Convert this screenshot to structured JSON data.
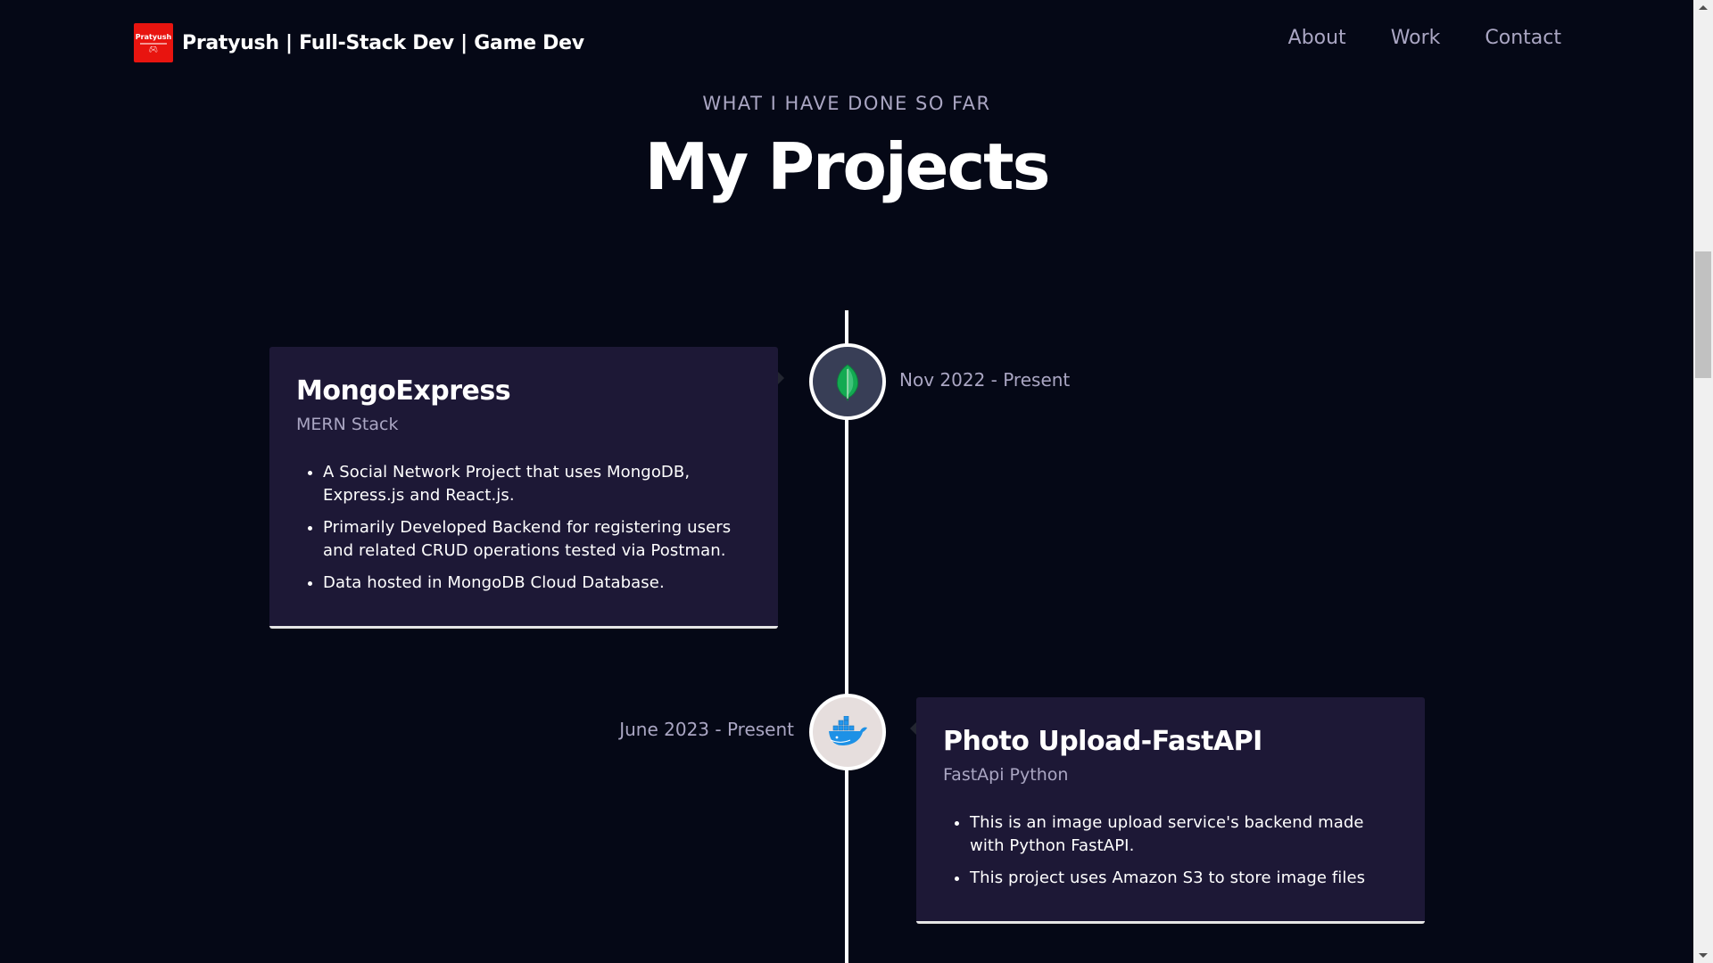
{
  "navbar": {
    "logo_text": "Pratyush",
    "logo_icon": "gamepad-icon",
    "brand": "Pratyush |  Full-Stack Dev | Game Dev",
    "links": [
      {
        "label": "About"
      },
      {
        "label": "Work"
      },
      {
        "label": "Contact"
      }
    ]
  },
  "section": {
    "subtitle": "WHAT I HAVE DONE SO FAR",
    "title": "My Projects"
  },
  "projects": [
    {
      "title": "MongoExpress",
      "subtitle": "MERN Stack",
      "date": "Nov 2022 - Present",
      "icon": "mongodb-leaf-icon",
      "icon_bg": "#383e56",
      "points": [
        "A Social Network Project that uses MongoDB, Express.js and React.js.",
        "Primarily Developed Backend for registering users and related CRUD operations tested via Postman.",
        "Data hosted in MongoDB Cloud Database."
      ]
    },
    {
      "title": "Photo Upload-FastAPI",
      "subtitle": "FastApi Python",
      "date": "June 2023 - Present",
      "icon": "docker-whale-icon",
      "icon_bg": "#e6dedd",
      "points": [
        "This is an image upload service's backend made with Python FastAPI.",
        "This project uses Amazon S3 to store image files"
      ]
    }
  ],
  "colors": {
    "background": "#050816",
    "card": "#1d1836",
    "secondary_text": "#aaa6c3",
    "logo_red": "#e8140f"
  }
}
